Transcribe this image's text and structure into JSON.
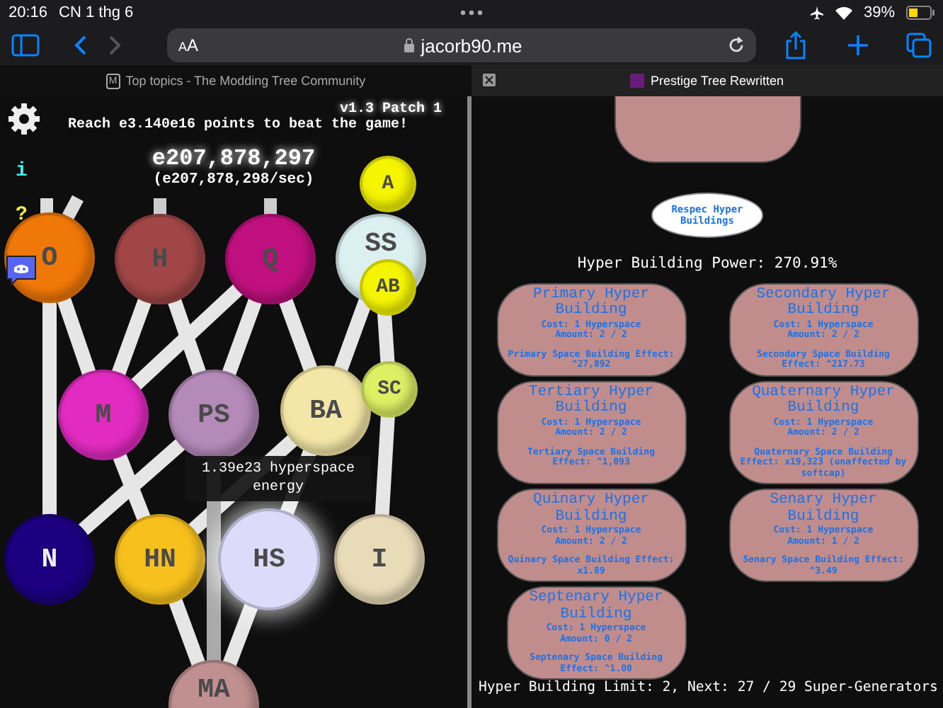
{
  "status_bar": {
    "time": "20:16",
    "date": "CN 1 thg 6",
    "battery": "39%"
  },
  "toolbar": {
    "text_size": "AA",
    "address": "jacorb90.me",
    "forward_disabled": true
  },
  "tabs": [
    {
      "favicon": "M",
      "label": "Top topics - The Modding Tree Community",
      "selected": false
    },
    {
      "label": "Prestige Tree Rewritten",
      "selected": true
    }
  ],
  "game": {
    "sidebar": [
      {
        "kind": "settings"
      },
      {
        "kind": "info",
        "label": "i"
      },
      {
        "kind": "help",
        "label": "?"
      },
      {
        "kind": "discord"
      }
    ],
    "version": "v1.3 Patch 1",
    "goal": "Reach e3.140e16 points to beat the game!",
    "points": "e207,878,297",
    "rate": "(e207,878,298/sec)",
    "nodes": [
      {
        "label": "A",
        "color": "#f5f500"
      },
      {
        "label": "O",
        "color": "#f07808"
      },
      {
        "label": "H",
        "color": "#a04646"
      },
      {
        "label": "Q",
        "color": "#c0107f"
      },
      {
        "label": "SS",
        "color": "#dcf0f2"
      },
      {
        "label": "AB",
        "color": "#f5f500"
      },
      {
        "label": "SC",
        "color": "#dcf064"
      },
      {
        "label": "M",
        "color": "#e22bc0"
      },
      {
        "label": "PS",
        "color": "#b48ab8"
      },
      {
        "label": "BA",
        "color": "#f4e6a6"
      },
      {
        "label": "N",
        "color": "#1c0080"
      },
      {
        "label": "HN",
        "color": "#f7c01c"
      },
      {
        "label": "HS",
        "color": "#dcdcfa"
      },
      {
        "label": "I",
        "color": "#e8dcb8"
      },
      {
        "label": "MA",
        "color": "#c09090"
      }
    ],
    "tooltip": "1.39e23 hyperspace energy"
  },
  "hyper": {
    "respec": "Respec Hyper Buildings",
    "power": "Hyper Building Power: 270.91%",
    "buildings": [
      {
        "title": "Primary Hyper Building",
        "cost": "Cost: 1 Hyperspace",
        "amount": "Amount: 2 / 2",
        "effect": "Primary Space Building Effect: ^27,892"
      },
      {
        "title": "Secondary Hyper Building",
        "cost": "Cost: 1 Hyperspace",
        "amount": "Amount: 2 / 2",
        "effect": "Secondary Space Building Effect: ^217.73"
      },
      {
        "title": "Tertiary Hyper Building",
        "cost": "Cost: 1 Hyperspace",
        "amount": "Amount: 2 / 2",
        "effect": "Tertiary Space Building Effect: ^1,093"
      },
      {
        "title": "Quaternary Hyper Building",
        "cost": "Cost: 1 Hyperspace",
        "amount": "Amount: 2 / 2",
        "effect": "Quaternary Space Building Effect: x19,323 (unaffected by softcap)"
      },
      {
        "title": "Quinary Hyper Building",
        "cost": "Cost: 1 Hyperspace",
        "amount": "Amount: 2 / 2",
        "effect": "Quinary Space Building Effect: x1.89"
      },
      {
        "title": "Senary Hyper Building",
        "cost": "Cost: 1 Hyperspace",
        "amount": "Amount: 1 / 2",
        "effect": "Senary Space Building Effect: ^3.49"
      },
      {
        "title": "Septenary Hyper Building",
        "cost": "Cost: 1 Hyperspace",
        "amount": "Amount: 0 / 2",
        "effect": "Septenary Space Building Effect: ^1.00"
      }
    ],
    "limit": "Hyper Building Limit: 2, Next: 27 / 29 Super-Generators"
  }
}
